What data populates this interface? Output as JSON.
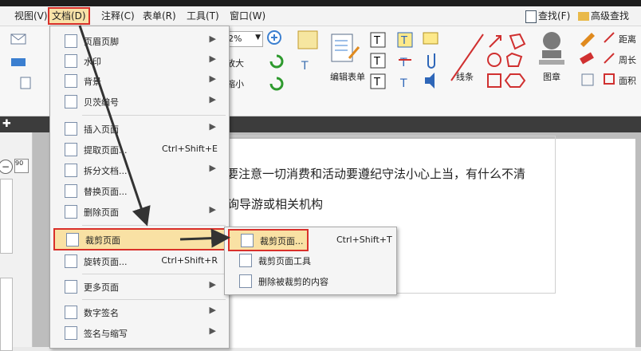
{
  "menubar": {
    "items": [
      "视图(V)",
      "文档(D)",
      "注释(C)",
      "表单(R)",
      "工具(T)",
      "窗口(W)"
    ],
    "find": "查找(F)",
    "advanced_find": "高级查找"
  },
  "ribbon": {
    "zoom_value": "2%",
    "zoom_in": "放大",
    "zoom_out": "缩小",
    "edit_form": "编辑表单",
    "line": "线条",
    "stamp": "图章",
    "distance": "距离",
    "perimeter": "周长",
    "area": "面积"
  },
  "document": {
    "line1": "意要注意一切消费和活动要遵纪守法小心上当，有什么不清",
    "line2": "询导游或相关机构"
  },
  "doc_menu": {
    "items": [
      {
        "label": "页眉页脚",
        "shortcut": "",
        "arrow": true
      },
      {
        "label": "水印",
        "shortcut": "",
        "arrow": true
      },
      {
        "label": "背景",
        "shortcut": "",
        "arrow": true
      },
      {
        "label": "贝茨编号",
        "shortcut": "",
        "arrow": true
      },
      {
        "label": "插入页面",
        "shortcut": "",
        "arrow": true
      },
      {
        "label": "提取页面...",
        "shortcut": "Ctrl+Shift+E",
        "arrow": false
      },
      {
        "label": "拆分文档...",
        "shortcut": "",
        "arrow": true
      },
      {
        "label": "替换页面...",
        "shortcut": "",
        "arrow": false
      },
      {
        "label": "删除页面",
        "shortcut": "",
        "arrow": true
      },
      {
        "label": "裁剪页面",
        "shortcut": "",
        "arrow": true
      },
      {
        "label": "旋转页面...",
        "shortcut": "Ctrl+Shift+R",
        "arrow": false
      },
      {
        "label": "更多页面",
        "shortcut": "",
        "arrow": true
      },
      {
        "label": "数字签名",
        "shortcut": "",
        "arrow": true
      },
      {
        "label": "签名与缩写",
        "shortcut": "",
        "arrow": true
      }
    ]
  },
  "crop_submenu": {
    "items": [
      {
        "label": "裁剪页面...",
        "shortcut": "Ctrl+Shift+T"
      },
      {
        "label": "裁剪页面工具",
        "shortcut": ""
      },
      {
        "label": "删除被裁剪的内容",
        "shortcut": ""
      }
    ]
  },
  "colors": {
    "highlight": "#d9302a",
    "selection": "#f9e1a4"
  }
}
